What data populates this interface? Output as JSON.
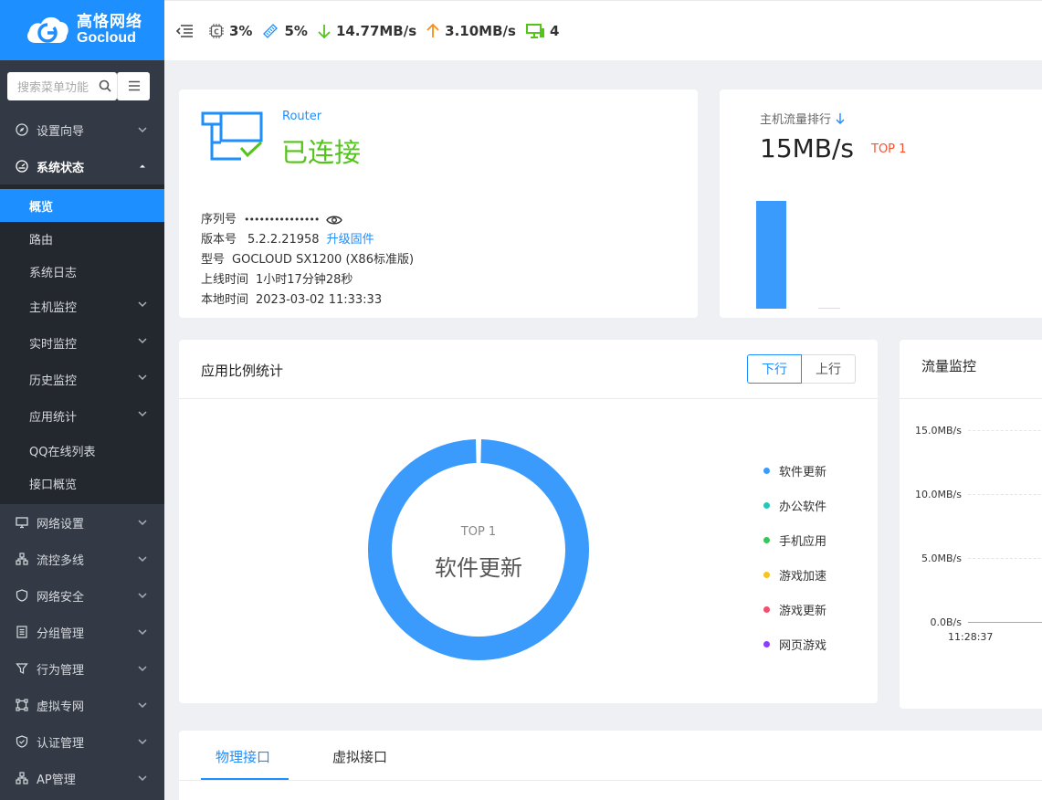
{
  "brand": {
    "name_cn": "高恪网络",
    "name_en": "Gocloud"
  },
  "sidebar": {
    "search_placeholder": "搜索菜单功能",
    "items_top": [
      {
        "label": "设置向导",
        "icon": "compass-icon"
      },
      {
        "label": "系统状态",
        "icon": "dashboard-icon",
        "open": true
      }
    ],
    "sub_items": [
      {
        "label": "概览",
        "active": true
      },
      {
        "label": "路由"
      },
      {
        "label": "系统日志"
      },
      {
        "label": "主机监控",
        "expandable": true
      },
      {
        "label": "实时监控",
        "expandable": true
      },
      {
        "label": "历史监控",
        "expandable": true
      },
      {
        "label": "应用统计",
        "expandable": true
      },
      {
        "label": "QQ在线列表"
      },
      {
        "label": "接口概览"
      }
    ],
    "items_bottom": [
      {
        "label": "网络设置",
        "icon": "monitor-icon"
      },
      {
        "label": "流控多线",
        "icon": "flow-icon"
      },
      {
        "label": "网络安全",
        "icon": "shield-icon"
      },
      {
        "label": "分组管理",
        "icon": "group-icon"
      },
      {
        "label": "行为管理",
        "icon": "filter-icon"
      },
      {
        "label": "虚拟专网",
        "icon": "vpn-icon"
      },
      {
        "label": "认证管理",
        "icon": "auth-icon"
      },
      {
        "label": "AP管理",
        "icon": "ap-icon"
      }
    ]
  },
  "topbar": {
    "cpu": "3%",
    "mem": "5%",
    "down": "14.77MB/s",
    "up": "3.10MB/s",
    "hosts": "4",
    "colors": {
      "down": "#52c41a",
      "up": "#fa8c16",
      "hosts": "#52c41a"
    }
  },
  "router": {
    "label": "Router",
    "status": "已连接",
    "serial_label": "序列号",
    "serial_value": "•••••••••••••••",
    "version_label": "版本号",
    "version_value": "5.2.2.21958",
    "upgrade_link": "升级固件",
    "model_label": "型号",
    "model_value": "GOCLOUD SX1200 (X86标准版)",
    "uptime_label": "上线时间",
    "uptime_value": "1小时17分钟28秒",
    "localtime_label": "本地时间",
    "localtime_value": "2023-03-02 11:33:33"
  },
  "traffic_rank": {
    "title": "主机流量排行",
    "value": "15MB/s",
    "top_label": "TOP 1",
    "top1_fraction": 1.0
  },
  "app_ratio": {
    "title": "应用比例统计",
    "toggle": {
      "down": "下行",
      "up": "上行"
    },
    "center_top": "TOP 1",
    "center_name": "软件更新",
    "legend": [
      {
        "label": "软件更新",
        "color": "#3a9bfd"
      },
      {
        "label": "办公软件",
        "color": "#26c6b8"
      },
      {
        "label": "手机应用",
        "color": "#34c759"
      },
      {
        "label": "游戏加速",
        "color": "#f7c31c"
      },
      {
        "label": "游戏更新",
        "color": "#f0506e"
      },
      {
        "label": "网页游戏",
        "color": "#8a3ffc"
      }
    ]
  },
  "flow": {
    "title": "流量监控",
    "y_ticks": [
      "15.0MB/s",
      "10.0MB/s",
      "5.0MB/s",
      "0.0B/s"
    ],
    "x_tick": "11:28:37"
  },
  "interfaces": {
    "tab_physical": "物理接口",
    "tab_virtual": "虚拟接口"
  }
}
